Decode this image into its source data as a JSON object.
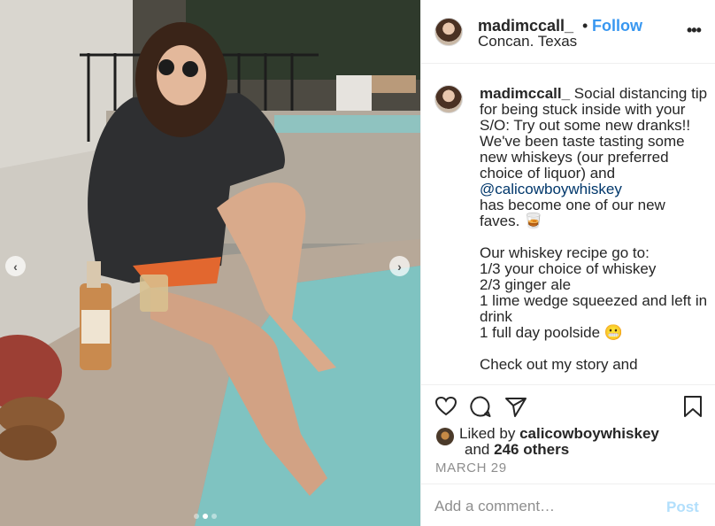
{
  "post": {
    "username": "madimccall_",
    "separator": "•",
    "follow_label": "Follow",
    "location": "Concan. Texas",
    "more_label": "•••"
  },
  "caption": {
    "username": "madimccall_",
    "text_before_mention": "Social distancing tip for being stuck inside with your S/O: Try out some new dranks!! We've been taste tasting some new whiskeys (our preferred choice of liquor) and ",
    "mention": "@calicowboywhiskey",
    "text_after_mention": "\nhas become one of our new faves. 🥃\n\nOur whiskey recipe go to:\n1/3 your choice of whiskey\n2/3 ginger ale\n1 lime wedge squeezed and left in drink\n1 full day poolside 😬\n\nCheck out my story and"
  },
  "likes": {
    "prefix": "Liked by",
    "user": "calicowboywhiskey",
    "and_label": "and",
    "others": "246 others"
  },
  "date": "MARCH 29",
  "comment": {
    "placeholder": "Add a comment…",
    "post_label": "Post"
  },
  "carousel": {
    "prev_icon": "chevron-left-icon",
    "next_icon": "chevron-right-icon",
    "total": 3,
    "active": 2
  },
  "colors": {
    "follow": "#3897f0",
    "mention": "#00376b",
    "post_disabled": "#b2dffc",
    "pool": "#7fc3c1"
  }
}
